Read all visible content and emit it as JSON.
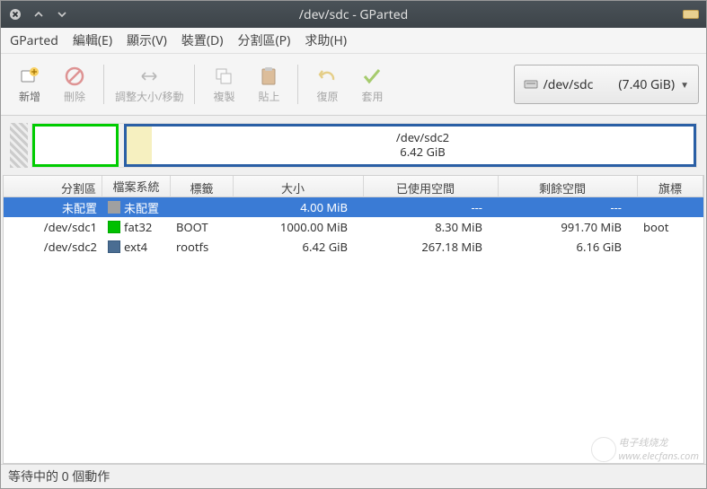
{
  "window": {
    "title": "/dev/sdc - GParted"
  },
  "menu": {
    "gparted": "GParted",
    "edit": "編輯(E)",
    "view": "顯示(V)",
    "device": "裝置(D)",
    "partition": "分割區(P)",
    "help": "求助(H)"
  },
  "toolbar": {
    "new": "新增",
    "delete": "刪除",
    "resize": "調整大小/移動",
    "copy": "複製",
    "paste": "貼上",
    "undo": "復原",
    "apply": "套用"
  },
  "device_selector": {
    "path": "/dev/sdc",
    "size": "(7.40 GiB)"
  },
  "diskmap": {
    "main_name": "/dev/sdc2",
    "main_size": "6.42 GiB"
  },
  "columns": {
    "partition": "分割區",
    "filesystem": "檔案系統",
    "label": "標籤",
    "size": "大小",
    "used": "已使用空間",
    "free": "剩餘空間",
    "flags": "旗標"
  },
  "rows": [
    {
      "partition": "未配置",
      "fs": "未配置",
      "fs_color": "unalloc",
      "label": "",
      "size": "4.00 MiB",
      "used": "---",
      "free": "---",
      "flags": "",
      "selected": true
    },
    {
      "partition": "/dev/sdc1",
      "fs": "fat32",
      "fs_color": "fat32",
      "label": "BOOT",
      "size": "1000.00 MiB",
      "used": "8.30 MiB",
      "free": "991.70 MiB",
      "flags": "boot",
      "selected": false
    },
    {
      "partition": "/dev/sdc2",
      "fs": "ext4",
      "fs_color": "ext4",
      "label": "rootfs",
      "size": "6.42 GiB",
      "used": "267.18 MiB",
      "free": "6.16 GiB",
      "flags": "",
      "selected": false
    }
  ],
  "status": "等待中的 0 個動作",
  "watermark": "www.elecfans.com"
}
